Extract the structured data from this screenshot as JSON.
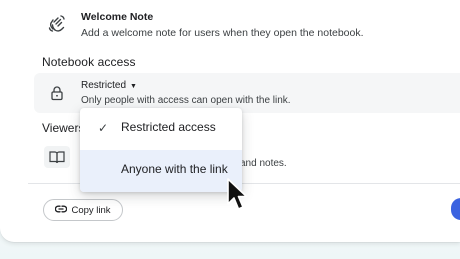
{
  "welcome": {
    "title": "Welcome Note",
    "description": "Add a welcome note for users when they open the notebook.",
    "icon": "hand-wave-icon"
  },
  "notebook_access": {
    "section_title": "Notebook access",
    "selected_value": "Restricted",
    "description": "Only people with access can open with the link.",
    "icon": "lock-icon"
  },
  "viewers": {
    "section_title": "Viewers",
    "description_fragment": "and notes.",
    "icon": "book-icon"
  },
  "access_menu": {
    "options": [
      {
        "label": "Restricted access",
        "selected": true
      },
      {
        "label": "Anyone with the link",
        "selected": false,
        "hovered": true
      }
    ]
  },
  "footer": {
    "copy_link_label": "Copy link",
    "icon": "link-icon"
  },
  "colors": {
    "accent": "#3b63e0",
    "hover": "#eaf0fb",
    "row_bg": "#f5f6f7"
  }
}
